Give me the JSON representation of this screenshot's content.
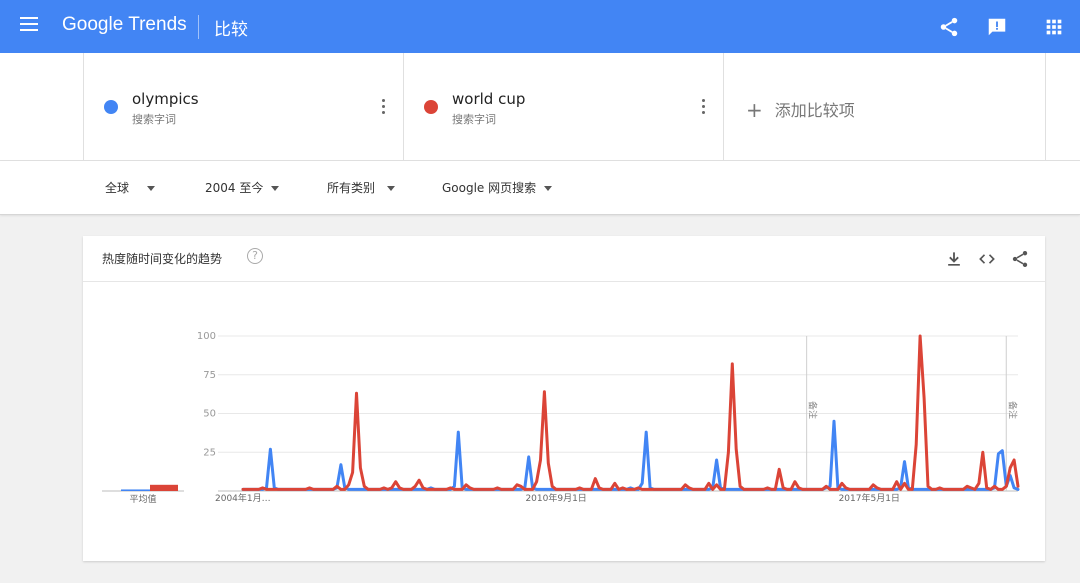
{
  "header": {
    "logo": "Google Trends",
    "page_title": "比较",
    "colors": {
      "bar": "#4285f4"
    }
  },
  "terms": [
    {
      "name": "olympics",
      "type": "搜索字词",
      "color": "#4285f4"
    },
    {
      "name": "world cup",
      "type": "搜索字词",
      "color": "#db4437"
    }
  ],
  "add_term": {
    "plus": "+",
    "label": "添加比较项"
  },
  "filters": {
    "region": "全球",
    "period": "2004 至今",
    "category": "所有类别",
    "search_type": "Google 网页搜索"
  },
  "card": {
    "title": "热度随时间变化的趋势",
    "help": "?"
  },
  "chart_data": {
    "type": "line",
    "title": "",
    "xlabel": "",
    "ylabel": "",
    "ylim": [
      0,
      100
    ],
    "y_ticks": [
      25,
      50,
      75,
      100
    ],
    "x_tick_labels": [
      "2004年1月…",
      "2010年9月1日",
      "2017年5月1日"
    ],
    "x_ticks_at": [
      "2004-01",
      "2010-09",
      "2017-05"
    ],
    "x_range": [
      "2004-01",
      "2020-07"
    ],
    "annotations": [
      {
        "date": "2016-01",
        "label": "备注"
      },
      {
        "date": "2020-04",
        "label": "备注"
      }
    ],
    "average_label": "平均值",
    "averages": [
      {
        "name": "olympics",
        "value": 1
      },
      {
        "name": "world cup",
        "value": 4
      }
    ],
    "series": [
      {
        "name": "olympics",
        "color": "#4285f4",
        "points": [
          [
            "2004-01",
            1
          ],
          [
            "2004-07",
            2
          ],
          [
            "2004-08",
            27
          ],
          [
            "2004-09",
            2
          ],
          [
            "2005-06",
            1
          ],
          [
            "2006-01",
            2
          ],
          [
            "2006-02",
            17
          ],
          [
            "2006-03",
            2
          ],
          [
            "2007-06",
            1
          ],
          [
            "2008-01",
            2
          ],
          [
            "2008-07",
            3
          ],
          [
            "2008-08",
            38
          ],
          [
            "2008-09",
            2
          ],
          [
            "2009-06",
            1
          ],
          [
            "2010-01",
            2
          ],
          [
            "2010-02",
            22
          ],
          [
            "2010-03",
            2
          ],
          [
            "2011-06",
            1
          ],
          [
            "2012-04",
            2
          ],
          [
            "2012-07",
            5
          ],
          [
            "2012-08",
            38
          ],
          [
            "2012-09",
            2
          ],
          [
            "2013-06",
            1
          ],
          [
            "2014-01",
            2
          ],
          [
            "2014-02",
            20
          ],
          [
            "2014-03",
            2
          ],
          [
            "2015-06",
            1
          ],
          [
            "2016-06",
            2
          ],
          [
            "2016-07",
            3
          ],
          [
            "2016-08",
            45
          ],
          [
            "2016-09",
            2
          ],
          [
            "2017-06",
            1
          ],
          [
            "2018-01",
            2
          ],
          [
            "2018-02",
            19
          ],
          [
            "2018-03",
            2
          ],
          [
            "2019-06",
            1
          ],
          [
            "2020-01",
            2
          ],
          [
            "2020-02",
            24
          ],
          [
            "2020-03",
            26
          ],
          [
            "2020-04",
            3
          ],
          [
            "2020-05",
            10
          ],
          [
            "2020-06",
            2
          ],
          [
            "2020-07",
            1
          ]
        ]
      },
      {
        "name": "world cup",
        "color": "#db4437",
        "points": [
          [
            "2004-01",
            1
          ],
          [
            "2004-06",
            2
          ],
          [
            "2005-06",
            2
          ],
          [
            "2006-01",
            3
          ],
          [
            "2006-04",
            4
          ],
          [
            "2006-05",
            12
          ],
          [
            "2006-06",
            63
          ],
          [
            "2006-07",
            15
          ],
          [
            "2006-08",
            3
          ],
          [
            "2007-01",
            2
          ],
          [
            "2007-03",
            2
          ],
          [
            "2007-04",
            6
          ],
          [
            "2007-05",
            2
          ],
          [
            "2007-09",
            3
          ],
          [
            "2007-10",
            7
          ],
          [
            "2007-11",
            2
          ],
          [
            "2008-06",
            2
          ],
          [
            "2008-10",
            4
          ],
          [
            "2008-11",
            2
          ],
          [
            "2009-06",
            2
          ],
          [
            "2009-11",
            4
          ],
          [
            "2009-12",
            3
          ],
          [
            "2010-04",
            6
          ],
          [
            "2010-05",
            20
          ],
          [
            "2010-06",
            64
          ],
          [
            "2010-07",
            18
          ],
          [
            "2010-08",
            3
          ],
          [
            "2011-03",
            2
          ],
          [
            "2011-07",
            8
          ],
          [
            "2011-08",
            2
          ],
          [
            "2011-12",
            5
          ],
          [
            "2012-02",
            2
          ],
          [
            "2012-06",
            2
          ],
          [
            "2013-06",
            4
          ],
          [
            "2013-07",
            2
          ],
          [
            "2013-12",
            5
          ],
          [
            "2014-02",
            4
          ],
          [
            "2014-05",
            25
          ],
          [
            "2014-06",
            82
          ],
          [
            "2014-07",
            27
          ],
          [
            "2014-08",
            3
          ],
          [
            "2015-03",
            2
          ],
          [
            "2015-06",
            14
          ],
          [
            "2015-07",
            2
          ],
          [
            "2015-10",
            6
          ],
          [
            "2015-11",
            2
          ],
          [
            "2016-06",
            3
          ],
          [
            "2016-07",
            1
          ],
          [
            "2016-10",
            5
          ],
          [
            "2016-11",
            2
          ],
          [
            "2017-06",
            4
          ],
          [
            "2017-07",
            2
          ],
          [
            "2017-12",
            6
          ],
          [
            "2018-02",
            5
          ],
          [
            "2018-05",
            30
          ],
          [
            "2018-06",
            100
          ],
          [
            "2018-07",
            60
          ],
          [
            "2018-08",
            3
          ],
          [
            "2018-11",
            2
          ],
          [
            "2019-06",
            3
          ],
          [
            "2019-07",
            2
          ],
          [
            "2019-09",
            5
          ],
          [
            "2019-10",
            25
          ],
          [
            "2019-11",
            2
          ],
          [
            "2020-01",
            3
          ],
          [
            "2020-04",
            3
          ],
          [
            "2020-05",
            15
          ],
          [
            "2020-06",
            20
          ],
          [
            "2020-07",
            3
          ]
        ]
      }
    ]
  }
}
